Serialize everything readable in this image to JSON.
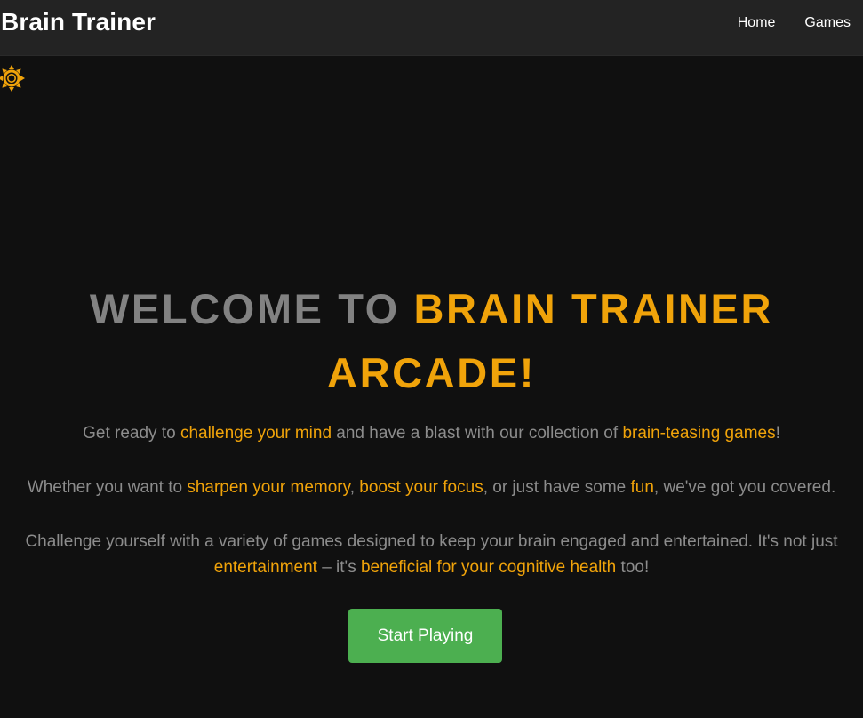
{
  "nav": {
    "brand": "Brain Trainer",
    "links": [
      "Home",
      "Games"
    ]
  },
  "theme_toggle": {
    "icon": "sun-icon",
    "color": "#f0a30a"
  },
  "hero": {
    "title_part1": "WELCOME TO ",
    "title_part2": "BRAIN TRAINER ARCADE!",
    "p1": {
      "a": "Get ready to ",
      "b": "challenge your mind",
      "c": " and have a blast with our collection of ",
      "d": "brain-teasing games",
      "e": "!"
    },
    "p2": {
      "a": "Whether you want to ",
      "b": "sharpen your memory",
      "c": ", ",
      "d": "boost your focus",
      "e": ", or just have some ",
      "f": "fun",
      "g": ", we've got you covered."
    },
    "p3": {
      "a": "Challenge yourself with a variety of games designed to keep your brain engaged and entertained. It's not just ",
      "b": "entertainment",
      "c": " – it's ",
      "d": "beneficial for your cognitive health",
      "e": " too!"
    },
    "cta": "Start Playing"
  },
  "colors": {
    "accent": "#f0a30a",
    "cta": "#4caf50",
    "background": "#101010",
    "navbar": "#232323"
  }
}
